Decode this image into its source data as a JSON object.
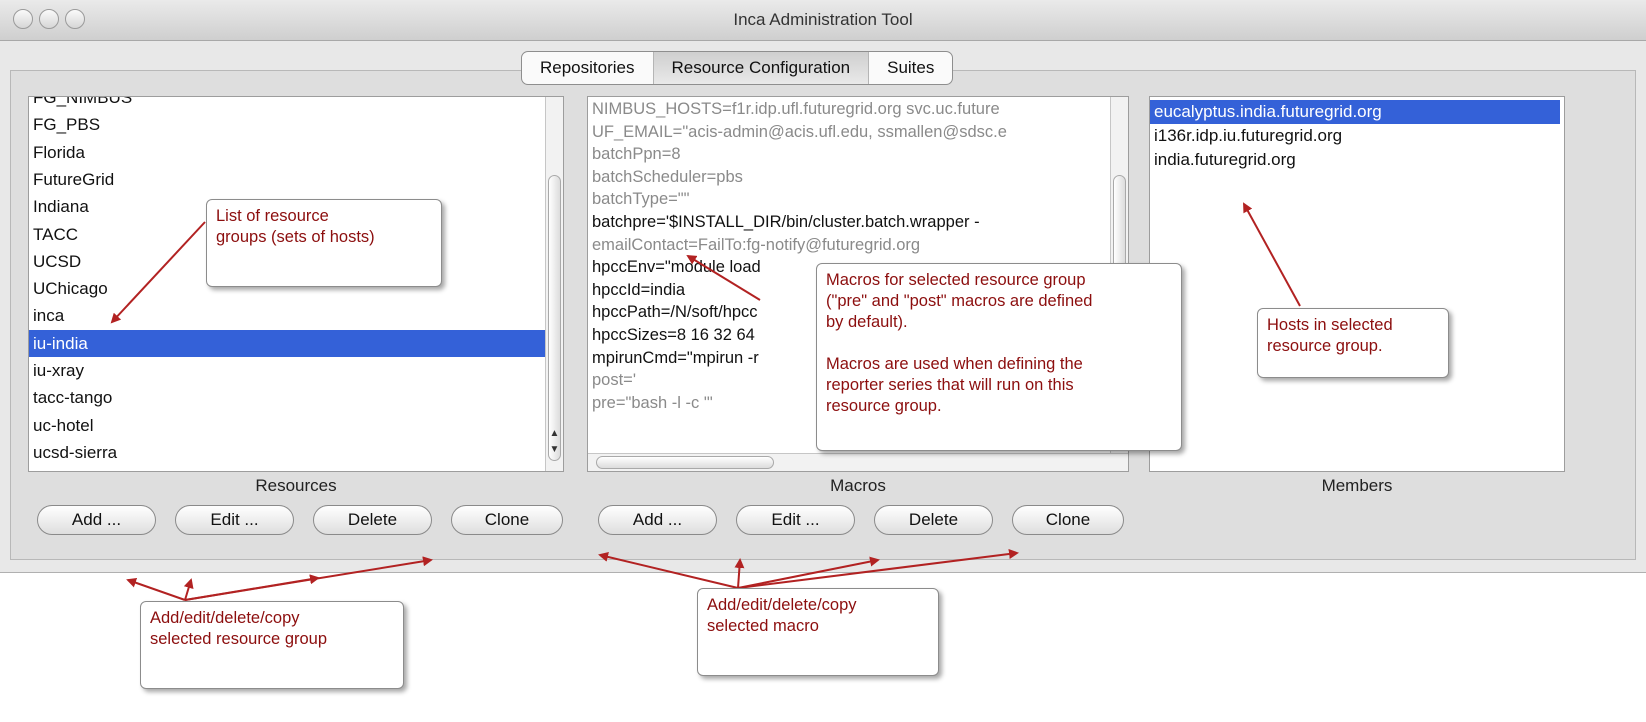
{
  "window": {
    "title": "Inca Administration Tool"
  },
  "tabs": [
    {
      "label": "Repositories",
      "selected": false
    },
    {
      "label": "Resource Configuration",
      "selected": true
    },
    {
      "label": "Suites",
      "selected": false
    }
  ],
  "resources": {
    "label": "Resources",
    "items": [
      "FG_NIMBUS",
      "FG_PBS",
      "Florida",
      "FutureGrid",
      "Indiana",
      "TACC",
      "UCSD",
      "UChicago",
      "inca",
      "iu-india",
      "iu-xray",
      "tacc-tango",
      "uc-hotel",
      "ucsd-sierra"
    ],
    "selected": "iu-india",
    "buttons": {
      "add": "Add ...",
      "edit": "Edit ...",
      "delete": "Delete",
      "clone": "Clone"
    }
  },
  "macros": {
    "label": "Macros",
    "lines": [
      "NIMBUS_HOSTS=f1r.idp.ufl.futuregrid.org svc.uc.future",
      "UF_EMAIL=\"acis-admin@acis.ufl.edu, ssmallen@sdsc.e",
      "batchPpn=8",
      "batchScheduler=pbs",
      "batchType=\"\"",
      "batchpre='$INSTALL_DIR/bin/cluster.batch.wrapper -",
      "emailContact=FailTo:fg-notify@futuregrid.org",
      "hpccEnv=\"module load",
      "hpccId=india",
      "hpccPath=/N/soft/hpcc",
      "hpccSizes=8 16 32 64",
      "mpirunCmd=\"mpirun -r",
      "post='",
      "pre=\"bash -l -c '\""
    ],
    "buttons": {
      "add": "Add ...",
      "edit": "Edit ...",
      "delete": "Delete",
      "clone": "Clone"
    }
  },
  "members": {
    "label": "Members",
    "items": [
      "eucalyptus.india.futuregrid.org",
      "i136r.idp.iu.futuregrid.org",
      "india.futuregrid.org"
    ],
    "selected": "eucalyptus.india.futuregrid.org"
  },
  "callouts": {
    "resource_groups": "List of resource\ngroups (sets of hosts)",
    "macros_info": "Macros for selected resource group\n(\"pre\" and \"post\" macros are defined\nby default).\n\nMacros are used when defining the\nreporter series that will run on this\nresource group.",
    "hosts": "Hosts in selected\nresource group.",
    "resource_buttons": "Add/edit/delete/copy\nselected resource group",
    "macro_buttons": "Add/edit/delete/copy\nselected macro"
  },
  "colors": {
    "selection": "#3461d8",
    "annotation_text": "#8c0e0e",
    "arrow": "#b22222"
  }
}
